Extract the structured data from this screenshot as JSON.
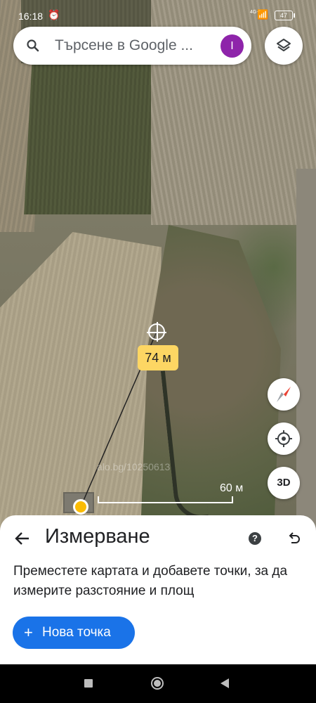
{
  "status_bar": {
    "time": "16:18",
    "alarm_icon": "⏰",
    "network": "4G+",
    "signal_icon": "📶",
    "battery": "47"
  },
  "search": {
    "placeholder": "Търсене в Google ...",
    "avatar_letter": "I",
    "avatar_color": "#8e24aa"
  },
  "map": {
    "distance_label": "74 м",
    "scale_label": "60 м",
    "watermark": "alo.bg/10250613",
    "three_d_label": "3D"
  },
  "measure_sheet": {
    "title": "Измерване",
    "help_label": "?",
    "description": "Преместете картата и добавете точки, за да измерите разстояние и площ",
    "new_point_plus": "+",
    "new_point_label": "Нова точка",
    "button_color": "#1a73e8"
  },
  "colors": {
    "distance_label_bg": "#fdd663",
    "point_color": "#fbbc04"
  }
}
